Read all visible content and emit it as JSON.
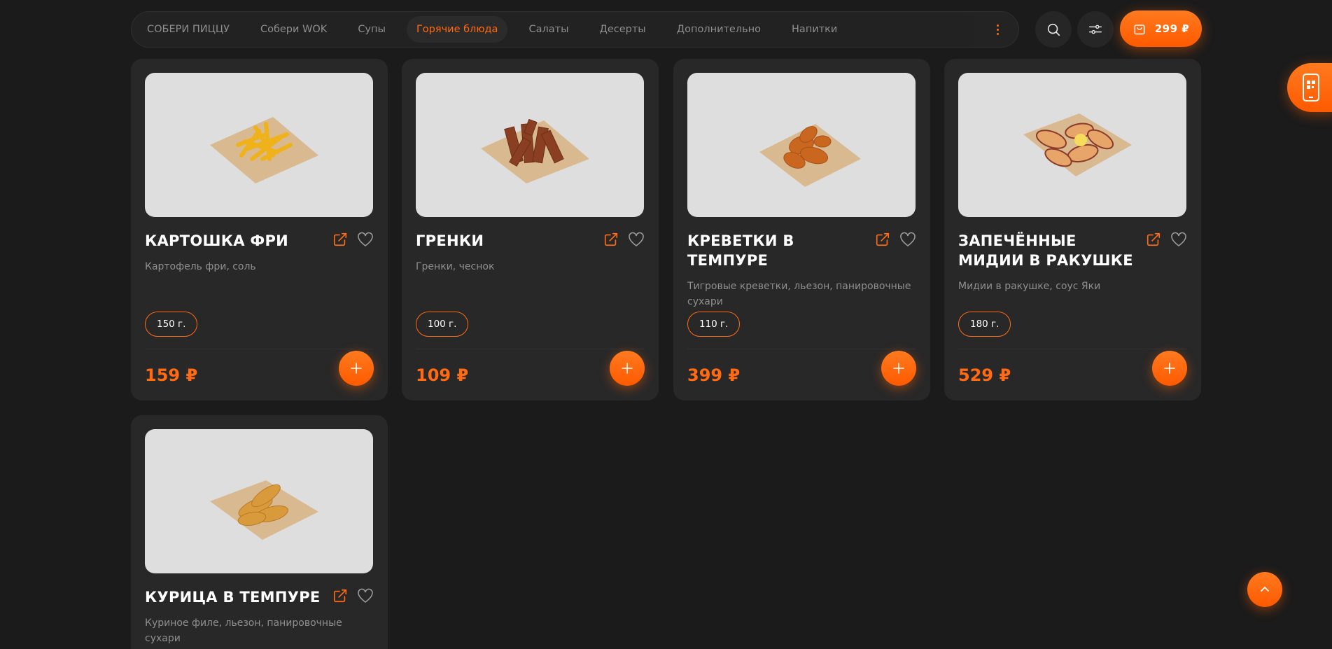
{
  "nav": {
    "tabs": [
      {
        "label": "СОБЕРИ ПИЦЦУ"
      },
      {
        "label": "Собери WOK"
      },
      {
        "label": "Супы"
      },
      {
        "label": "Горячие блюда",
        "active": true
      },
      {
        "label": "Салаты"
      },
      {
        "label": "Десерты"
      },
      {
        "label": "Дополнительно"
      },
      {
        "label": "Напитки"
      }
    ],
    "more_icon": "vertical-dots-icon"
  },
  "header": {
    "search_icon": "search-icon",
    "filter_icon": "sliders-icon",
    "cart": {
      "icon": "shopping-bag-icon",
      "total": "299 ₽"
    }
  },
  "app_tab": {
    "icon": "mobile-app-qr-icon"
  },
  "products": [
    {
      "title": "КАРТОШКА ФРИ",
      "description": "Картофель фри, соль",
      "weight": "150 г.",
      "price": "159 ₽",
      "image": "fries"
    },
    {
      "title": "ГРЕНКИ",
      "description": "Гренки, чеснок",
      "weight": "100 г.",
      "price": "109 ₽",
      "image": "croutons"
    },
    {
      "title": "КРЕВЕТКИ В ТЕМПУРЕ",
      "description": "Тигровые креветки, льезон, панировочные сухари",
      "weight": "110 г.",
      "price": "399 ₽",
      "image": "shrimp"
    },
    {
      "title": "ЗАПЕЧЁННЫЕ МИДИИ В РАКУШКЕ",
      "description": "Мидии в ракушке, соус Яки",
      "weight": "180 г.",
      "price": "529 ₽",
      "image": "mussels"
    },
    {
      "title": "КУРИЦА В ТЕМПУРЕ",
      "description": "Куриное филе, льезон, панировочные сухари",
      "weight": "",
      "price": "",
      "image": "chicken"
    }
  ],
  "colors": {
    "accent": "#ff6a13",
    "background": "#1b1b1b",
    "card": "#282828",
    "image_bg": "#dedede"
  }
}
